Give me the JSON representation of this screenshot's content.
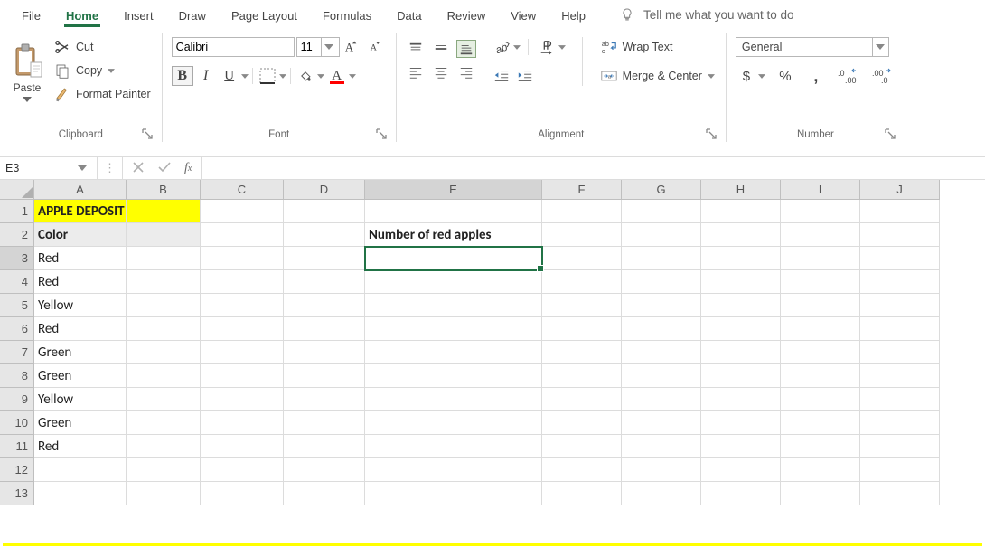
{
  "menu": {
    "items": [
      "File",
      "Home",
      "Insert",
      "Draw",
      "Page Layout",
      "Formulas",
      "Data",
      "Review",
      "View",
      "Help"
    ],
    "active": "Home",
    "tell_me": "Tell me what you want to do"
  },
  "ribbon": {
    "clipboard": {
      "paste": "Paste",
      "cut": "Cut",
      "copy": "Copy",
      "format_painter": "Format Painter",
      "group_label": "Clipboard"
    },
    "font": {
      "name": "Calibri",
      "size": "11",
      "group_label": "Font"
    },
    "alignment": {
      "wrap_text": "Wrap Text",
      "merge_center": "Merge & Center",
      "group_label": "Alignment"
    },
    "number": {
      "format": "General",
      "currency": "$",
      "percent": "%",
      "comma": ",",
      "group_label": "Number"
    }
  },
  "namebox": {
    "value": "E3"
  },
  "formula": {
    "value": ""
  },
  "columns": [
    "A",
    "B",
    "C",
    "D",
    "E",
    "F",
    "G",
    "H",
    "I",
    "J"
  ],
  "rows": [
    1,
    2,
    3,
    4,
    5,
    6,
    7,
    8,
    9,
    10,
    11,
    12,
    13
  ],
  "selected_cell": "E3",
  "cells": {
    "A1": "APPLE DEPOSIT",
    "A2": "Color",
    "E2": "Number of red apples",
    "A3": "Red",
    "A4": "Red",
    "A5": "Yellow",
    "A6": "Red",
    "A7": "Green",
    "A8": "Green",
    "A9": "Yellow",
    "A10": "Green",
    "A11": "Red"
  }
}
